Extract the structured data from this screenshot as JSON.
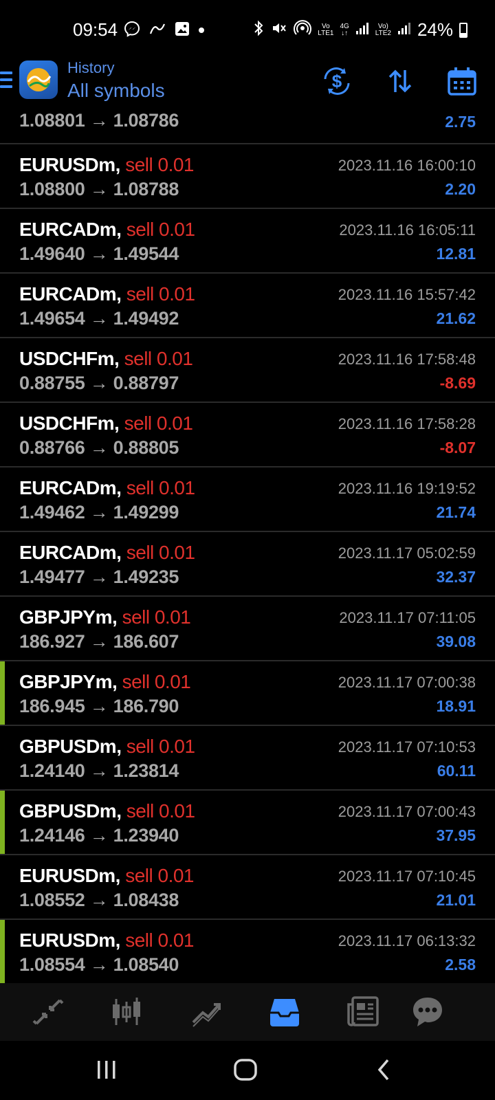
{
  "status_bar": {
    "time": "09:54",
    "battery": "24%",
    "volte1": "Vo",
    "lte1": "LTE1",
    "net4g": "4G",
    "volte2": "Vo)",
    "lte2": "LTE2"
  },
  "header": {
    "subtitle": "History",
    "title": "All symbols"
  },
  "partial_row": {
    "open": "1.08801",
    "close": "1.08786",
    "profit": "2.75"
  },
  "trades": [
    {
      "symbol": "EURUSDm,",
      "side": "sell 0.01",
      "open": "1.08800",
      "close": "1.08788",
      "time": "2023.11.16 16:00:10",
      "profit": "2.20"
    },
    {
      "symbol": "EURCADm,",
      "side": "sell 0.01",
      "open": "1.49640",
      "close": "1.49544",
      "time": "2023.11.16 16:05:11",
      "profit": "12.81"
    },
    {
      "symbol": "EURCADm,",
      "side": "sell 0.01",
      "open": "1.49654",
      "close": "1.49492",
      "time": "2023.11.16 15:57:42",
      "profit": "21.62"
    },
    {
      "symbol": "USDCHFm,",
      "side": "sell 0.01",
      "open": "0.88755",
      "close": "0.88797",
      "time": "2023.11.16 17:58:48",
      "profit": "-8.69"
    },
    {
      "symbol": "USDCHFm,",
      "side": "sell 0.01",
      "open": "0.88766",
      "close": "0.88805",
      "time": "2023.11.16 17:58:28",
      "profit": "-8.07"
    },
    {
      "symbol": "EURCADm,",
      "side": "sell 0.01",
      "open": "1.49462",
      "close": "1.49299",
      "time": "2023.11.16 19:19:52",
      "profit": "21.74"
    },
    {
      "symbol": "EURCADm,",
      "side": "sell 0.01",
      "open": "1.49477",
      "close": "1.49235",
      "time": "2023.11.17 05:02:59",
      "profit": "32.37"
    },
    {
      "symbol": "GBPJPYm,",
      "side": "sell 0.01",
      "open": "186.927",
      "close": "186.607",
      "time": "2023.11.17 07:11:05",
      "profit": "39.08"
    },
    {
      "symbol": "GBPJPYm,",
      "side": "sell 0.01",
      "open": "186.945",
      "close": "186.790",
      "time": "2023.11.17 07:00:38",
      "profit": "18.91"
    },
    {
      "symbol": "GBPUSDm,",
      "side": "sell 0.01",
      "open": "1.24140",
      "close": "1.23814",
      "time": "2023.11.17 07:10:53",
      "profit": "60.11"
    },
    {
      "symbol": "GBPUSDm,",
      "side": "sell 0.01",
      "open": "1.24146",
      "close": "1.23940",
      "time": "2023.11.17 07:00:43",
      "profit": "37.95"
    },
    {
      "symbol": "EURUSDm,",
      "side": "sell 0.01",
      "open": "1.08552",
      "close": "1.08438",
      "time": "2023.11.17 07:10:45",
      "profit": "21.01"
    },
    {
      "symbol": "EURUSDm,",
      "side": "sell 0.01",
      "open": "1.08554",
      "close": "1.08540",
      "time": "2023.11.17 06:13:32",
      "profit": "2.58"
    }
  ],
  "arrow": "→",
  "colors": {
    "accent": "#3d8dff",
    "sell": "#e0312c",
    "profit_positive": "#3a7ee8",
    "profit_negative": "#e0312c",
    "marker": "#7fb320"
  },
  "tabs": [
    {
      "icon": "quotes-icon",
      "active": false
    },
    {
      "icon": "chart-icon",
      "active": false
    },
    {
      "icon": "trade-icon",
      "active": false
    },
    {
      "icon": "history-icon",
      "active": true
    },
    {
      "icon": "news-icon",
      "active": false
    },
    {
      "icon": "chat-icon",
      "active": false
    }
  ]
}
